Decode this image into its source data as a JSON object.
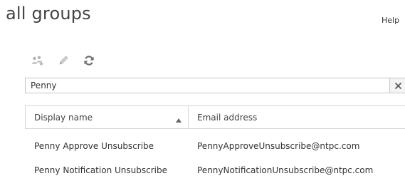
{
  "page": {
    "title": "all groups",
    "help_label": "Help"
  },
  "toolbar": {
    "items": [
      {
        "icon": "group-members-icon"
      },
      {
        "icon": "pencil-edit-icon"
      },
      {
        "icon": "refresh-icon"
      }
    ]
  },
  "search": {
    "value": "Penny"
  },
  "grid": {
    "columns": [
      {
        "label": "Display name",
        "sort": "ascending"
      },
      {
        "label": "Email address"
      }
    ],
    "rows": [
      {
        "display_name": "Penny Approve Unsubscribe",
        "email": "PennyApproveUnsubscribe@ntpc.com"
      },
      {
        "display_name": "Penny Notification Unsubscribe",
        "email": "PennyNotificationUnsubscribe@ntpc.com"
      }
    ]
  },
  "colors": {
    "icon_gray": "#b3b3b3",
    "refresh_gray": "#6e6e6e",
    "border": "#d5d5d5"
  }
}
